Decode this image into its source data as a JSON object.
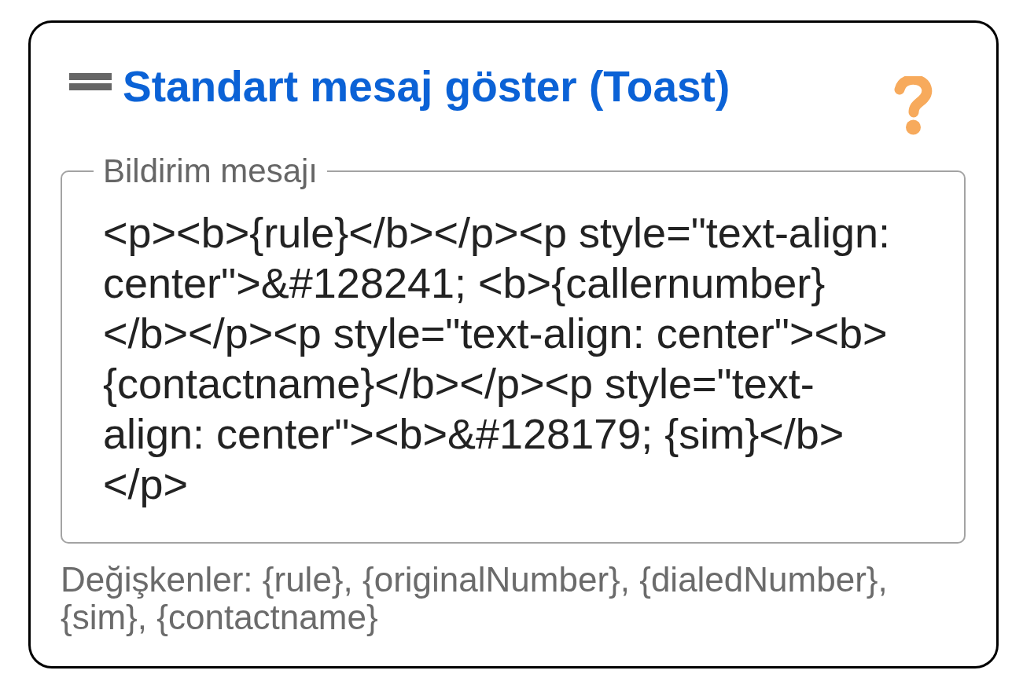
{
  "header": {
    "title": "Standart mesaj göster (Toast)"
  },
  "message_field": {
    "label": "Bildirim mesajı",
    "value": "<p><b>{rule}</b></p><p style=\"text-align: center\">&#128241; <b>{callernumber}</b></p><p style=\"text-align: center\"><b>{contactname}</b></p><p style=\"text-align: center\"><b>&#128179; {sim}</b></p>"
  },
  "hint": "Değişkenler: {rule}, {originalNumber}, {dialedNumber}, {sim}, {contactname}"
}
